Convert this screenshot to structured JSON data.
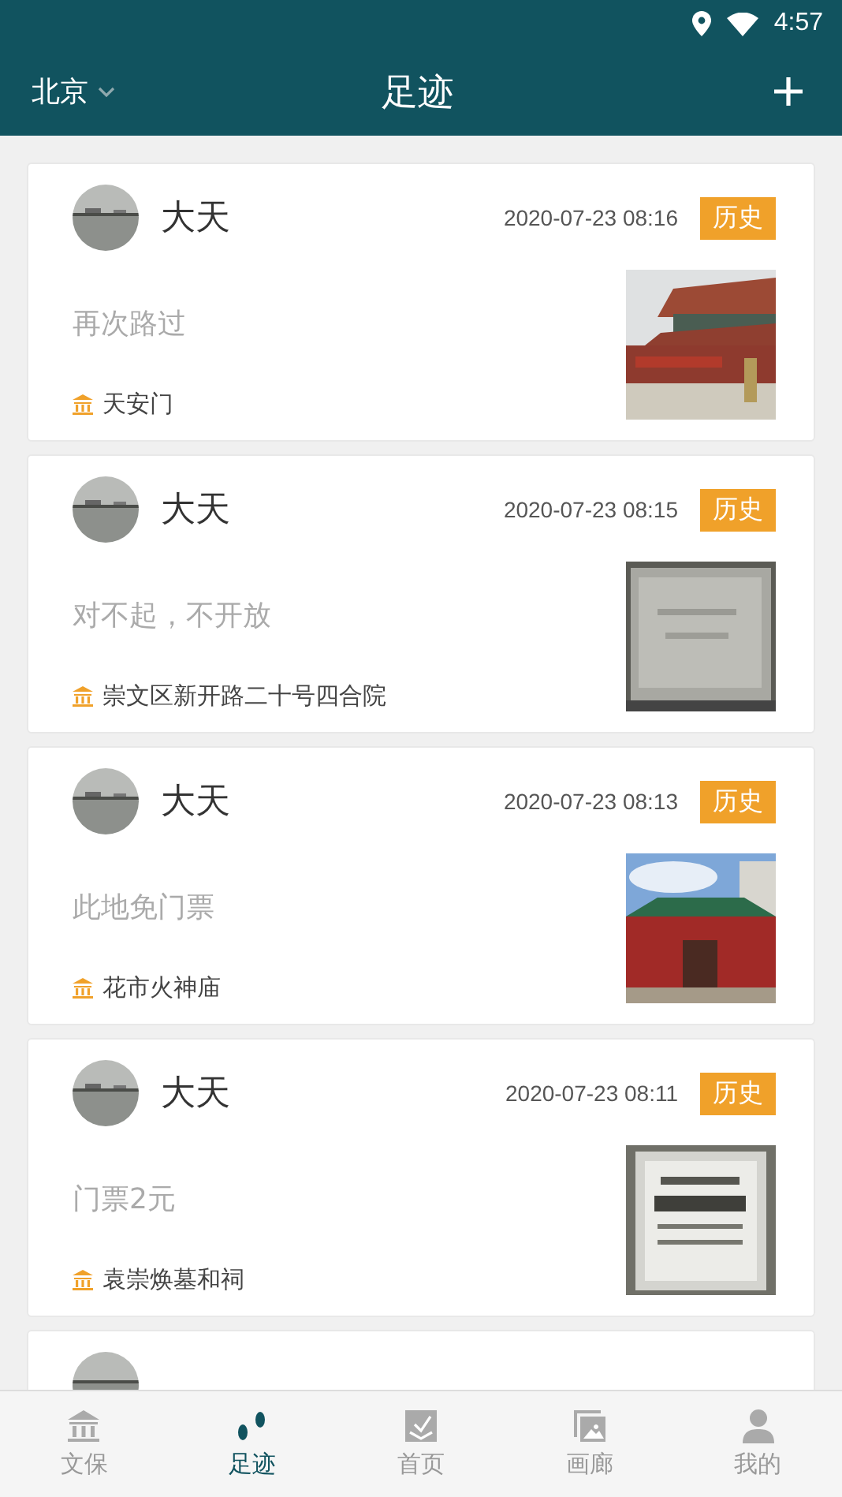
{
  "status_bar": {
    "time": "4:57"
  },
  "header": {
    "city": "北京",
    "title": "足迹"
  },
  "posts": [
    {
      "user": "大天",
      "time": "2020-07-23 08:16",
      "tag": "历史",
      "text": "再次路过",
      "place": "天安门"
    },
    {
      "user": "大天",
      "time": "2020-07-23 08:15",
      "tag": "历史",
      "text": "对不起，不开放",
      "place": "崇文区新开路二十号四合院"
    },
    {
      "user": "大天",
      "time": "2020-07-23 08:13",
      "tag": "历史",
      "text": "此地免门票",
      "place": "花市火神庙"
    },
    {
      "user": "大天",
      "time": "2020-07-23 08:11",
      "tag": "历史",
      "text": "门票2元",
      "place": "袁崇焕墓和祠"
    }
  ],
  "tabs": [
    {
      "label": "文保",
      "selected": false
    },
    {
      "label": "足迹",
      "selected": true
    },
    {
      "label": "首页",
      "selected": false
    },
    {
      "label": "画廊",
      "selected": false
    },
    {
      "label": "我的",
      "selected": false
    }
  ]
}
